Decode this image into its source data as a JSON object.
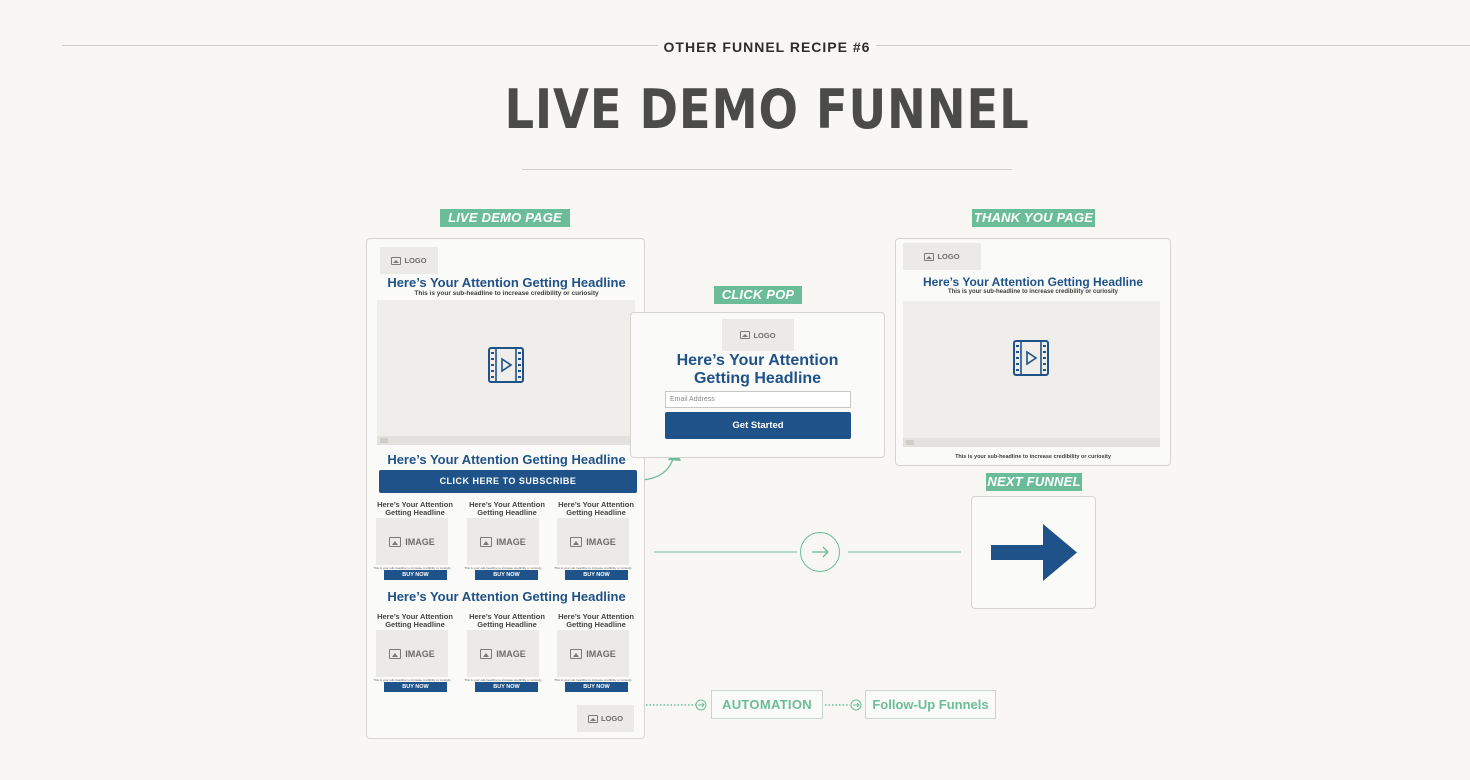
{
  "header": {
    "recipe_label": "OTHER FUNNEL RECIPE #6",
    "title": "LIVE DEMO FUNNEL"
  },
  "colors": {
    "accent_green": "#6bbd99",
    "brand_blue": "#1f5288",
    "background": "#f8f7f4"
  },
  "live_demo_page": {
    "tag": "LIVE DEMO PAGE",
    "logo": "LOGO",
    "headline": "Here’s Your Attention Getting Headline",
    "subheadline": "This is your sub-headline to increase credibility or curiosity",
    "video_icon": "video-play-icon",
    "headline2": "Here’s Your Attention Getting Headline",
    "subscribe_button": "CLICK HERE TO SUBSCRIBE",
    "products_row1": [
      {
        "title": "Here’s Your Attention Getting Headline",
        "image": "IMAGE",
        "caption": "This is your sub-headline to increase credibility or curiosity",
        "button": "BUY NOW"
      },
      {
        "title": "Here’s Your Attention Getting Headline",
        "image": "IMAGE",
        "caption": "This is your sub-headline to increase credibility or curiosity",
        "button": "BUY NOW"
      },
      {
        "title": "Here’s Your Attention Getting Headline",
        "image": "IMAGE",
        "caption": "This is your sub-headline to increase credibility or curiosity",
        "button": "BUY NOW"
      }
    ],
    "headline3": "Here’s Your Attention Getting Headline",
    "products_row2": [
      {
        "title": "Here’s Your Attention Getting Headline",
        "image": "IMAGE",
        "caption": "This is your sub-headline to increase credibility or curiosity",
        "button": "BUY NOW"
      },
      {
        "title": "Here’s Your Attention Getting Headline",
        "image": "IMAGE",
        "caption": "This is your sub-headline to increase credibility or curiosity",
        "button": "BUY NOW"
      },
      {
        "title": "Here’s Your Attention Getting Headline",
        "image": "IMAGE",
        "caption": "This is your sub-headline to increase credibility or curiosity",
        "button": "BUY NOW"
      }
    ],
    "footer_logo": "LOGO"
  },
  "click_pop": {
    "tag": "CLICK POP",
    "logo": "LOGO",
    "headline_line1": "Here’s Your Attention",
    "headline_line2": "Getting Headline",
    "email_placeholder": "Email Address",
    "button": "Get Started"
  },
  "thank_you_page": {
    "tag": "THANK YOU PAGE",
    "logo": "LOGO",
    "headline": "Here’s Your Attention Getting Headline",
    "subheadline": "This is your sub-headline to increase credibility or curiosity",
    "video_icon": "video-play-icon",
    "caption": "This is your sub-headline to increase credibility or curiosity"
  },
  "next_funnel": {
    "tag": "NEXT FUNNEL",
    "icon": "arrow-right-icon"
  },
  "automation": {
    "box": "AUTOMATION",
    "followup": "Follow-Up Funnels"
  }
}
